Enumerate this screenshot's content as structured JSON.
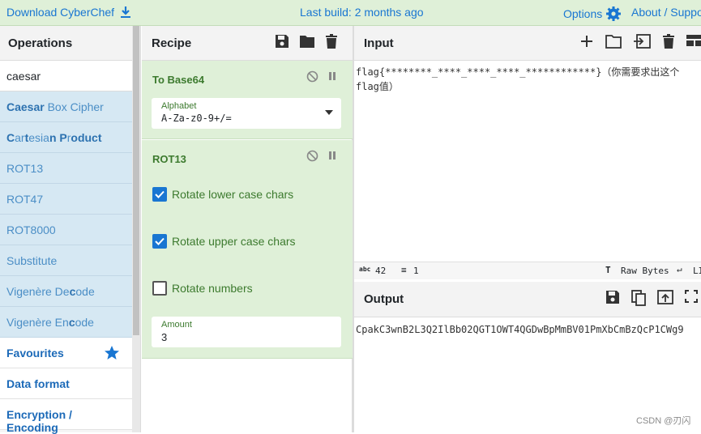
{
  "topbar": {
    "download_label": "Download CyberChef",
    "last_build": "Last build: 2 months ago",
    "options_label": "Options",
    "about_label": "About / Suppo"
  },
  "operations": {
    "title": "Operations",
    "search_value": "caesar",
    "results": [
      {
        "bold": "Caesar",
        "rest": " Box Cipher"
      },
      {
        "segments": [
          "C",
          "ar",
          "t",
          "esia",
          "n P",
          "r",
          "oduct"
        ]
      },
      {
        "plain": "ROT13"
      },
      {
        "plain": "ROT47"
      },
      {
        "plain": "ROT8000"
      },
      {
        "plain": "Substitute"
      },
      {
        "prefix": "Vigenère De",
        "bold": "c",
        "suffix": "ode"
      },
      {
        "prefix": "Vigenère En",
        "bold": "c",
        "suffix": "ode"
      }
    ],
    "categories": [
      "Favourites",
      "Data format",
      "Encryption / Encoding"
    ]
  },
  "recipe": {
    "title": "Recipe",
    "ingredients": {
      "to_base64": {
        "name": "To Base64",
        "alphabet_label": "Alphabet",
        "alphabet_value": "A-Za-z0-9+/="
      },
      "rot13": {
        "name": "ROT13",
        "lower_label": "Rotate lower case chars",
        "lower_checked": true,
        "upper_label": "Rotate upper case chars",
        "upper_checked": true,
        "numbers_label": "Rotate numbers",
        "numbers_checked": false,
        "amount_label": "Amount",
        "amount_value": "3"
      }
    }
  },
  "input": {
    "title": "Input",
    "text_line1": "flag{********_****_****_****_************}（你需要求出这个",
    "text_line2": "flag值）",
    "status": {
      "chars": "42",
      "lines": "1",
      "raw_bytes": "Raw Bytes",
      "eol": "LI"
    }
  },
  "output": {
    "title": "Output",
    "text": "CpakC3wnB2L3Q2IlBb02QGT1OWT4QGDwBpMmBV01PmXbCmBzQcP1CWg9"
  },
  "watermark": "CSDN @刃闪",
  "colors": {
    "accent": "#1976d2",
    "recipe_bg": "#dff0d8",
    "op_bg": "#d6e8f3"
  }
}
